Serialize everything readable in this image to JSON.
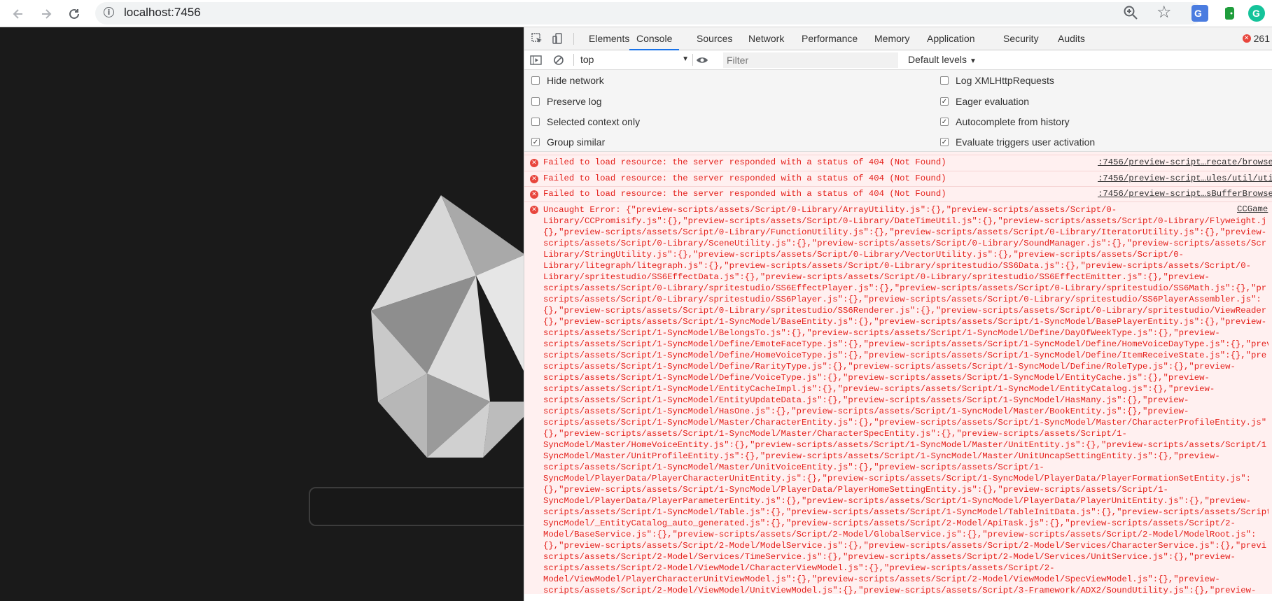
{
  "browser": {
    "url": "localhost:7456",
    "nav_icons": [
      "back-icon",
      "forward-icon",
      "reload-icon",
      "info-icon"
    ],
    "right_icons": [
      "zoom-icon",
      "star-icon",
      "translate-extension-icon",
      "evernote-extension-icon",
      "grammarly-extension-icon"
    ]
  },
  "devtools": {
    "tabs": [
      "Elements",
      "Console",
      "Sources",
      "Network",
      "Performance",
      "Memory",
      "Application",
      "Security",
      "Audits"
    ],
    "active_tab": "Console",
    "error_count": "261",
    "console_bar": {
      "context": "top",
      "filter_placeholder": "Filter",
      "levels": "Default levels"
    },
    "settings_left": [
      {
        "label": "Hide network",
        "checked": false
      },
      {
        "label": "Preserve log",
        "checked": false
      },
      {
        "label": "Selected context only",
        "checked": false
      },
      {
        "label": "Group similar",
        "checked": true
      }
    ],
    "settings_right": [
      {
        "label": "Log XMLHttpRequests",
        "checked": false
      },
      {
        "label": "Eager evaluation",
        "checked": true
      },
      {
        "label": "Autocomplete from history",
        "checked": true
      },
      {
        "label": "Evaluate triggers user activation",
        "checked": true
      }
    ],
    "messages": [
      {
        "text": "Failed to load resource: the server responded with a status of 404 (Not Found)",
        "source": ":7456/preview-script…recate/browse"
      },
      {
        "text": "Failed to load resource: the server responded with a status of 404 (Not Found)",
        "source": ":7456/preview-script…ules/util/uti"
      },
      {
        "text": "Failed to load resource: the server responded with a status of 404 (Not Found)",
        "source": ":7456/preview-script…sBufferBrowse"
      }
    ],
    "uncaught_error": {
      "source": "CCGame",
      "lines": [
        "Uncaught Error: {\"preview-scripts/assets/Script/0-Library/ArrayUtility.js\":{},\"preview-scripts/assets/Script/0-",
        "Library/CCPromisify.js\":{},\"preview-scripts/assets/Script/0-Library/DateTimeUtil.js\":{},\"preview-scripts/assets/Script/0-Library/Flyweight.j",
        "{},\"preview-scripts/assets/Script/0-Library/FunctionUtility.js\":{},\"preview-scripts/assets/Script/0-Library/IteratorUtility.js\":{},\"preview-",
        "scripts/assets/Script/0-Library/SceneUtility.js\":{},\"preview-scripts/assets/Script/0-Library/SoundManager.js\":{},\"preview-scripts/assets/Scr",
        "Library/StringUtility.js\":{},\"preview-scripts/assets/Script/0-Library/VectorUtility.js\":{},\"preview-scripts/assets/Script/0-",
        "Library/litegraph/litegraph.js\":{},\"preview-scripts/assets/Script/0-Library/spritestudio/SS6Data.js\":{},\"preview-scripts/assets/Script/0-",
        "Library/spritestudio/SS6EffectData.js\":{},\"preview-scripts/assets/Script/0-Library/spritestudio/SS6EffectEmitter.js\":{},\"preview-",
        "scripts/assets/Script/0-Library/spritestudio/SS6EffectPlayer.js\":{},\"preview-scripts/assets/Script/0-Library/spritestudio/SS6Math.js\":{},\"pr",
        "scripts/assets/Script/0-Library/spritestudio/SS6Player.js\":{},\"preview-scripts/assets/Script/0-Library/spritestudio/SS6PlayerAssembler.js\":",
        "{},\"preview-scripts/assets/Script/0-Library/spritestudio/SS6Renderer.js\":{},\"preview-scripts/assets/Script/0-Library/spritestudio/ViewReader",
        "{},\"preview-scripts/assets/Script/1-SyncModel/BaseEntity.js\":{},\"preview-scripts/assets/Script/1-SyncModel/BasePlayerEntity.js\":{},\"preview-",
        "scripts/assets/Script/1-SyncModel/BelongsTo.js\":{},\"preview-scripts/assets/Script/1-SyncModel/Define/DayOfWeekType.js\":{},\"preview-",
        "scripts/assets/Script/1-SyncModel/Define/EmoteFaceType.js\":{},\"preview-scripts/assets/Script/1-SyncModel/Define/HomeVoiceDayType.js\":{},\"prev",
        "scripts/assets/Script/1-SyncModel/Define/HomeVoiceType.js\":{},\"preview-scripts/assets/Script/1-SyncModel/Define/ItemReceiveState.js\":{},\"pre",
        "scripts/assets/Script/1-SyncModel/Define/RarityType.js\":{},\"preview-scripts/assets/Script/1-SyncModel/Define/RoleType.js\":{},\"preview-",
        "scripts/assets/Script/1-SyncModel/Define/VoiceType.js\":{},\"preview-scripts/assets/Script/1-SyncModel/EntityCache.js\":{},\"preview-",
        "scripts/assets/Script/1-SyncModel/EntityCacheImpl.js\":{},\"preview-scripts/assets/Script/1-SyncModel/EntityCatalog.js\":{},\"preview-",
        "scripts/assets/Script/1-SyncModel/EntityUpdateData.js\":{},\"preview-scripts/assets/Script/1-SyncModel/HasMany.js\":{},\"preview-",
        "scripts/assets/Script/1-SyncModel/HasOne.js\":{},\"preview-scripts/assets/Script/1-SyncModel/Master/BookEntity.js\":{},\"preview-",
        "scripts/assets/Script/1-SyncModel/Master/CharacterEntity.js\":{},\"preview-scripts/assets/Script/1-SyncModel/Master/CharacterProfileEntity.js\"",
        "{},\"preview-scripts/assets/Script/1-SyncModel/Master/CharacterSpecEntity.js\":{},\"preview-scripts/assets/Script/1-",
        "SyncModel/Master/HomeVoiceEntity.js\":{},\"preview-scripts/assets/Script/1-SyncModel/Master/UnitEntity.js\":{},\"preview-scripts/assets/Script/1",
        "SyncModel/Master/UnitProfileEntity.js\":{},\"preview-scripts/assets/Script/1-SyncModel/Master/UnitUncapSettingEntity.js\":{},\"preview-",
        "scripts/assets/Script/1-SyncModel/Master/UnitVoiceEntity.js\":{},\"preview-scripts/assets/Script/1-",
        "SyncModel/PlayerData/PlayerCharacterUnitEntity.js\":{},\"preview-scripts/assets/Script/1-SyncModel/PlayerData/PlayerFormationSetEntity.js\":",
        "{},\"preview-scripts/assets/Script/1-SyncModel/PlayerData/PlayerHomeSettingEntity.js\":{},\"preview-scripts/assets/Script/1-",
        "SyncModel/PlayerData/PlayerParameterEntity.js\":{},\"preview-scripts/assets/Script/1-SyncModel/PlayerData/PlayerUnitEntity.js\":{},\"preview-",
        "scripts/assets/Script/1-SyncModel/Table.js\":{},\"preview-scripts/assets/Script/1-SyncModel/TableInitData.js\":{},\"preview-scripts/assets/Script",
        "SyncModel/_EntityCatalog_auto_generated.js\":{},\"preview-scripts/assets/Script/2-Model/ApiTask.js\":{},\"preview-scripts/assets/Script/2-",
        "Model/BaseService.js\":{},\"preview-scripts/assets/Script/2-Model/GlobalService.js\":{},\"preview-scripts/assets/Script/2-Model/ModelRoot.js\":",
        "{},\"preview-scripts/assets/Script/2-Model/ModelService.js\":{},\"preview-scripts/assets/Script/2-Model/Services/CharacterService.js\":{},\"previ",
        "scripts/assets/Script/2-Model/Services/TimeService.js\":{},\"preview-scripts/assets/Script/2-Model/Services/UnitService.js\":{},\"preview-",
        "scripts/assets/Script/2-Model/ViewModel/CharacterViewModel.js\":{},\"preview-scripts/assets/Script/2-",
        "Model/ViewModel/PlayerCharacterUnitViewModel.js\":{},\"preview-scripts/assets/Script/2-Model/ViewModel/SpecViewModel.js\":{},\"preview-",
        "scripts/assets/Script/2-Model/ViewModel/UnitViewModel.js\":{},\"preview-scripts/assets/Script/3-Framework/ADX2/SoundUtility.js\":{},\"preview-"
      ]
    }
  },
  "colors": {
    "error_red": "#e4201b",
    "error_bg": "#fff0f0",
    "tab_active": "#1a73e8",
    "page_bg": "#1a1a1a"
  }
}
